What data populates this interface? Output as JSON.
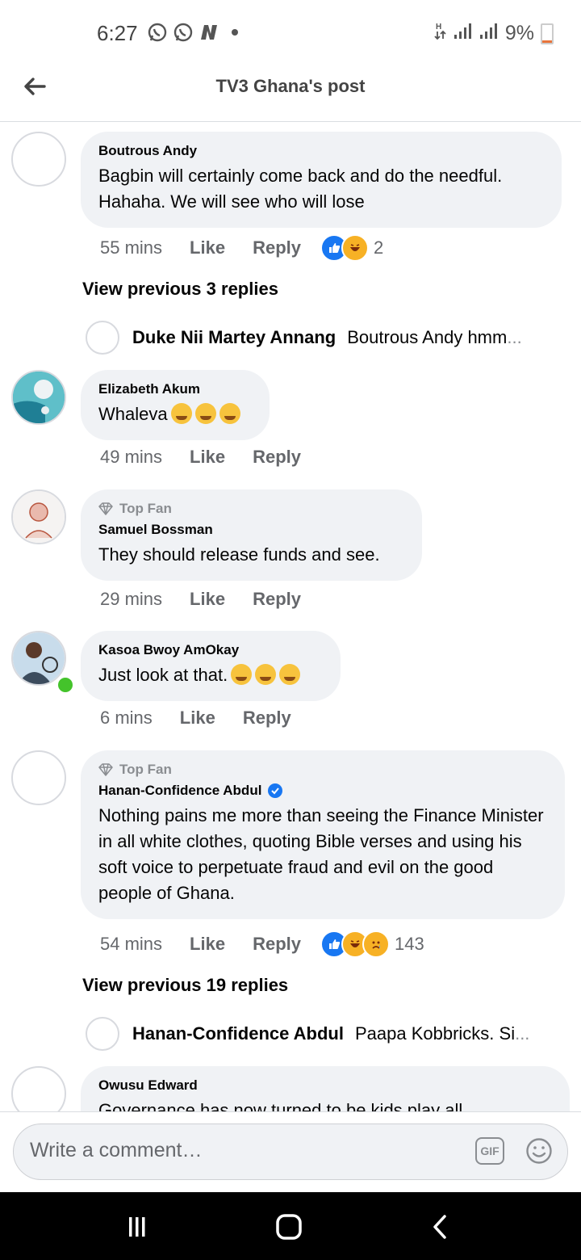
{
  "status": {
    "time": "6:27",
    "battery": "9%",
    "icons": [
      "whatsapp-icon",
      "whatsapp-icon",
      "n-icon",
      "dot-icon"
    ],
    "right_icons": [
      "data-arrows-icon",
      "signal-icon",
      "signal-icon",
      "battery-icon"
    ]
  },
  "header": {
    "title": "TV3 Ghana's post",
    "back_icon": "back-arrow-icon"
  },
  "comments": [
    {
      "author": "Boutrous Andy",
      "text": "Bagbin will certainly come back and do the needful. Hahaha. We will see who will lose",
      "time": "55 mins",
      "like": "Like",
      "reply": "Reply",
      "reactions": [
        "like",
        "haha"
      ],
      "reaction_count": "2"
    },
    {
      "author": "Elizabeth Akum",
      "text": "Whaleva",
      "emojis": 3,
      "time": "49 mins",
      "like": "Like",
      "reply": "Reply"
    },
    {
      "badge": "Top Fan",
      "author": "Samuel Bossman",
      "text": "They should release funds and see.",
      "time": "29 mins",
      "like": "Like",
      "reply": "Reply"
    },
    {
      "author": "Kasoa Bwoy AmOkay",
      "text": "Just look at that.",
      "emojis": 3,
      "time": "6 mins",
      "like": "Like",
      "reply": "Reply",
      "online": true
    },
    {
      "badge": "Top Fan",
      "author": "Hanan-Confidence Abdul",
      "verified": true,
      "text": "Nothing pains me more than seeing the Finance Minister in all white clothes, quoting Bible verses and using his soft voice to perpetuate fraud and evil on the good people of Ghana.",
      "time": "54 mins",
      "like": "Like",
      "reply": "Reply",
      "reactions": [
        "like",
        "haha",
        "sad"
      ],
      "reaction_count": "143"
    },
    {
      "author": "Owusu Edward",
      "text": "Governance has now turned to be kids play all"
    }
  ],
  "view_previous": [
    "View previous 3 replies",
    "View previous 19 replies"
  ],
  "reply_previews": [
    {
      "name": "Duke Nii Martey Annang",
      "snippet": "Boutrous Andy hmm",
      "ellipsis": "..."
    },
    {
      "name": "Hanan-Confidence Abdul",
      "snippet": "Paapa Kobbricks. Si",
      "ellipsis": "..."
    }
  ],
  "composer": {
    "placeholder": "Write a comment…",
    "gif_label": "GIF"
  },
  "colors": {
    "accent": "#1877f2",
    "bubble": "#f0f2f5",
    "online": "#44c32b",
    "meta": "#65676b"
  }
}
